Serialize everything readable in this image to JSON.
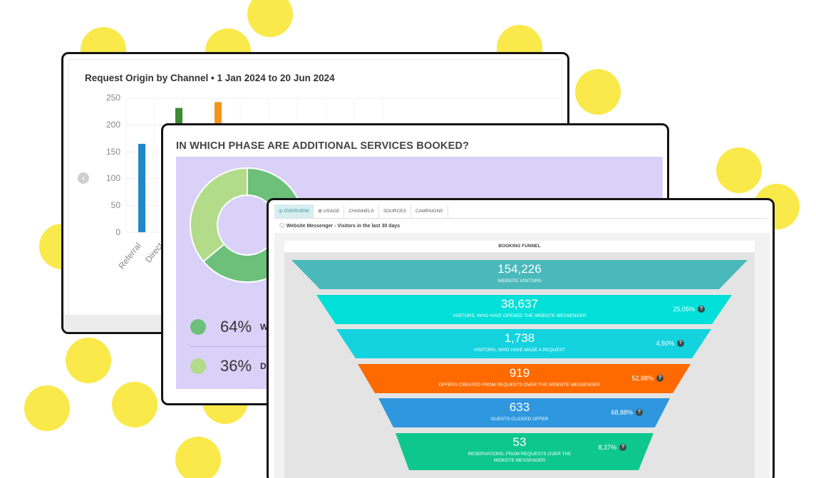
{
  "colors": {
    "accent_yellow": "#f9e94a",
    "bar_blue": "#1e88c9",
    "bar_green": "#3c8a35",
    "bar_orange": "#f5941d",
    "donut_dark": "#6cc07a",
    "donut_light": "#b2db8a",
    "panel_lavender": "#d9d1f7",
    "funnel_teal": "#4ab9b9",
    "funnel_cyan": "#00e0d8",
    "funnel_cyan2": "#14d3df",
    "funnel_orange": "#ff6a00",
    "funnel_blue": "#2e97de",
    "funnel_green": "#0ec78d"
  },
  "request_origin": {
    "title": "Request Origin by Channel • 1 Jan 2024 to 20 Jun 2024",
    "nav_icon": "chevron-left-icon",
    "chart_data": {
      "type": "bar",
      "title": "Request Origin by Channel • 1 Jan 2024 to 20 Jun 2024",
      "y_ticks": [
        "250",
        "200",
        "150",
        "100",
        "50",
        "0"
      ],
      "ylim": [
        0,
        250
      ],
      "grid": true,
      "categories": [
        "Referral",
        "Direct"
      ],
      "bars": [
        {
          "value": 165,
          "color": "#1e88c9"
        },
        {
          "value": 232,
          "color": "#3c8a35"
        },
        {
          "value": 243,
          "color": "#f5941d"
        }
      ]
    }
  },
  "phase": {
    "title": "IN WHICH PHASE ARE ADDITIONAL SERVICES BOOKED?",
    "chart_data": {
      "type": "pie",
      "slices": [
        {
          "value": 64,
          "color": "#6cc07a"
        },
        {
          "value": 36,
          "color": "#b2db8a"
        }
      ]
    },
    "legend": [
      {
        "pct": "64%",
        "label": "W",
        "color": "#6cc07a"
      },
      {
        "pct": "36%",
        "label": "DI",
        "color": "#b2db8a"
      }
    ]
  },
  "dashboard": {
    "tabs": [
      {
        "label": "◎ OVERVIEW",
        "active": true
      },
      {
        "label": "⊞ USAGE",
        "active": false
      },
      {
        "label": "CHANNELS",
        "active": false
      },
      {
        "label": "SOURCES",
        "active": false
      },
      {
        "label": "CAMPAIGNS",
        "active": false
      }
    ],
    "subheader_icon": "chat-bubble-icon",
    "subheader": "Website Messenger - Visitors in the last 30 days",
    "funnel_title": "BOOKING FUNNEL",
    "funnel": [
      {
        "value": "154,226",
        "label": "WEBSITE VISITORS",
        "rate": "",
        "color": "#4ab9b9"
      },
      {
        "value": "38,637",
        "label": "VISITORS, WHO HAVE OPENED THE WEBSITE MESSENGER",
        "rate": "25,05%",
        "color": "#00e0d8"
      },
      {
        "value": "1,738",
        "label": "VISITORS, WHO HAVE MADE A REQUEST",
        "rate": "4,50%",
        "color": "#14d3df"
      },
      {
        "value": "919",
        "label": "OFFERS CREATED FROM REQUESTS OVER THE WEBSITE MESSENGER",
        "rate": "52,88%",
        "color": "#ff6a00"
      },
      {
        "value": "633",
        "label": "GUESTS CLICKED OFFER",
        "rate": "68,88%",
        "color": "#2e97de"
      },
      {
        "value": "53",
        "label": "RESERVATIONS, FROM REQUESTS OVER THE WEBSITE MESSENGER",
        "rate": "8,37%",
        "color": "#0ec78d"
      }
    ],
    "help_glyph": "?"
  }
}
